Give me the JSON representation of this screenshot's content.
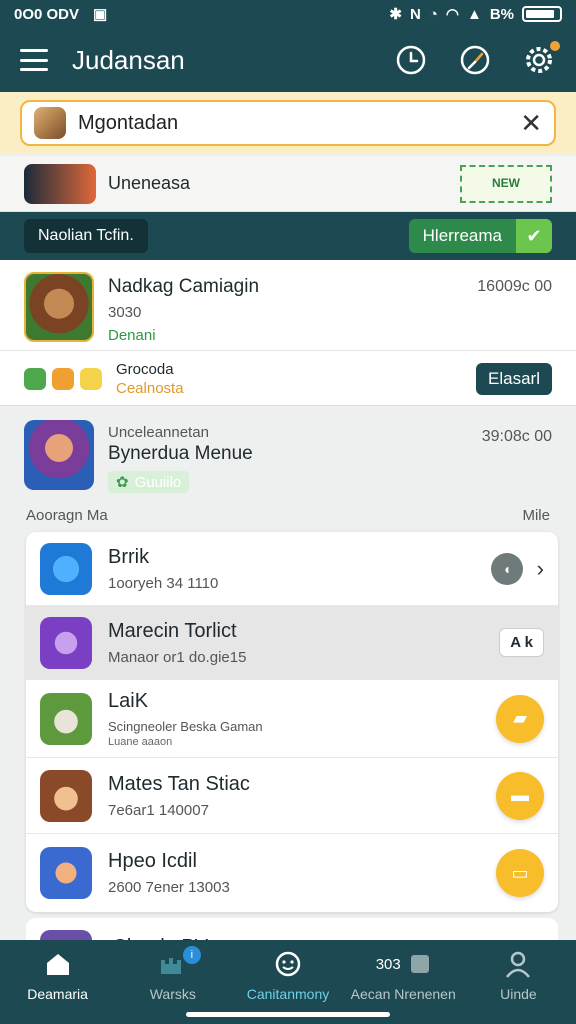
{
  "status_bar": {
    "left_text": "0O0 ODV",
    "battery_text": "B%"
  },
  "header": {
    "title": "Judansan"
  },
  "search": {
    "value": "Mgontadan"
  },
  "featured": {
    "label": "Uneneasa",
    "badge": "NEW"
  },
  "action_bar": {
    "pill": "Naolian Tcfin.",
    "button": "Hlerreama"
  },
  "campaign": {
    "title": "Nadkag Camiagin",
    "subtitle": "3030",
    "status": "Denani",
    "time": "16009c 00",
    "bottom_title": "Grocoda",
    "bottom_sub": "Cealnosta",
    "button": "Elasarl"
  },
  "feature2": {
    "overline": "Unceleannetan",
    "title": "Bynerdua Menue",
    "tag": "Guuiilo",
    "time": "39:08c 00"
  },
  "section": {
    "title": "Aooragn Ma",
    "more": "Mile"
  },
  "list": {
    "items": [
      {
        "title": "Brrik",
        "sub": "1ooryeh 34 1110"
      },
      {
        "title": "Marecin Torlict",
        "sub": "Manaor or1 do.gie15",
        "action": "A k"
      },
      {
        "title": "LaiK",
        "sub": "Scingneoler Beska Gaman",
        "meta": "Luane aaaon"
      },
      {
        "title": "Mates Tan Stiac",
        "sub": "7e6ar1 140007"
      },
      {
        "title": "Hpeo Icdil",
        "sub": "2600 7ener 13003"
      }
    ],
    "partial_title": "Cloade PV"
  },
  "bottom_nav": {
    "items": [
      {
        "label": "Deamaria"
      },
      {
        "label": "Warsks"
      },
      {
        "label": "Canitanmony"
      },
      {
        "label": "Aecan Nrenenen",
        "glyph_text": "303"
      },
      {
        "label": "Uinde"
      }
    ],
    "badge": "i"
  },
  "colors": {
    "primary": "#1d4a52",
    "accent_yellow": "#f7bd2a",
    "accent_green": "#2e8a4a"
  }
}
